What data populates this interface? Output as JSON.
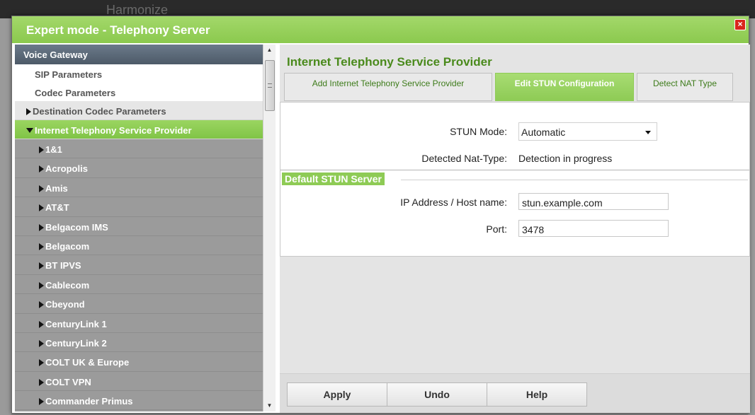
{
  "backdrop": {
    "brand": "",
    "brand_sub": "Harmonize"
  },
  "dialog": {
    "title": "Expert mode - Telephony Server",
    "close_label": "×"
  },
  "nav": {
    "section": "Voice Gateway",
    "sub_items": [
      "SIP Parameters",
      "Codec Parameters"
    ],
    "items": [
      {
        "label": "Destination Codec Parameters",
        "expanded": false,
        "active": false
      },
      {
        "label": "Internet Telephony Service Provider",
        "expanded": true,
        "active": true
      }
    ],
    "providers": [
      "1&1",
      "Acropolis",
      "Amis",
      "AT&T",
      "Belgacom IMS",
      "Belgacom",
      "BT IPVS",
      "Cablecom",
      "Cbeyond",
      "CenturyLink 1",
      "CenturyLink 2",
      "COLT UK & Europe",
      "COLT VPN",
      "Commander Primus"
    ]
  },
  "content": {
    "title": "Internet Telephony Service Provider",
    "tabs": [
      {
        "label": "Add Internet Telephony Service Provider",
        "active": false
      },
      {
        "label": "Edit STUN Configuration",
        "active": true
      },
      {
        "label": "Detect NAT Type",
        "active": false
      }
    ],
    "stun_mode_label": "STUN Mode:",
    "stun_mode_value": "Automatic",
    "detected_nat_label": "Detected Nat-Type:",
    "detected_nat_value": "Detection in progress",
    "group_title": "Default STUN Server",
    "ip_label": "IP Address / Host name:",
    "ip_value": "stun.example.com",
    "port_label": "Port:",
    "port_value": "3478"
  },
  "footer": {
    "apply": "Apply",
    "undo": "Undo",
    "help": "Help"
  },
  "colors": {
    "header_green": "#8bc94e",
    "title_green": "#4a8a1c",
    "nav_section": "#4d5a68",
    "close_red": "#d9261c"
  }
}
